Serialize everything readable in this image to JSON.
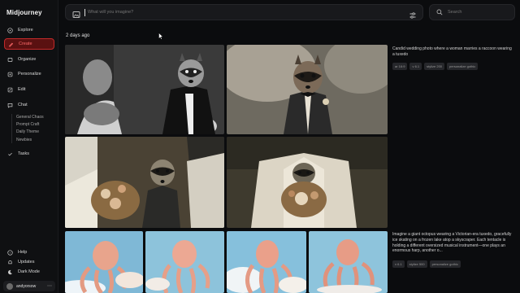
{
  "app": {
    "title": "Midjourney"
  },
  "sidebar": {
    "items": [
      {
        "label": "Explore",
        "icon": "compass-icon"
      },
      {
        "label": "Create",
        "icon": "brush-icon",
        "active": true
      },
      {
        "label": "Organize",
        "icon": "folder-icon"
      },
      {
        "label": "Personalize",
        "icon": "sliders-icon"
      },
      {
        "label": "Edit",
        "icon": "edit-icon"
      },
      {
        "label": "Chat",
        "icon": "chat-icon"
      },
      {
        "label": "Tasks",
        "icon": "tasks-icon"
      }
    ],
    "chat_rooms": [
      "General Chaos",
      "Prompt Craft",
      "Daily Theme",
      "Newbies"
    ],
    "footer": [
      {
        "label": "Help",
        "icon": "help-icon"
      },
      {
        "label": "Updates",
        "icon": "bell-icon"
      },
      {
        "label": "Dark Mode",
        "icon": "moon-icon"
      }
    ],
    "user": {
      "name": "andyorsow"
    }
  },
  "prompt": {
    "placeholder": "What will you imagine?"
  },
  "search": {
    "placeholder": "Search"
  },
  "feed": {
    "date_label": "2 days ago",
    "jobs": [
      {
        "caption": "Candid wedding photo where a woman marries a raccoon wearing a tuxedo",
        "tags": [
          "ar 16:9",
          "v 6.1",
          "stylize 200",
          "personalize gothic"
        ]
      },
      {
        "caption": "Imagine a giant octopus wearing a Victorian-era tuxedo, gracefully ice skating on a frozen lake atop a skyscraper. Each tentacle is holding a different oversized musical instrument—one plays an enormous harp, another o...",
        "tags": [
          "v 6.1",
          "stylize 500",
          "personalize gothic"
        ]
      }
    ]
  },
  "colors": {
    "accent": "#c12a2a",
    "accent_bg": "#5a1111",
    "background": "#0b0c0e"
  }
}
